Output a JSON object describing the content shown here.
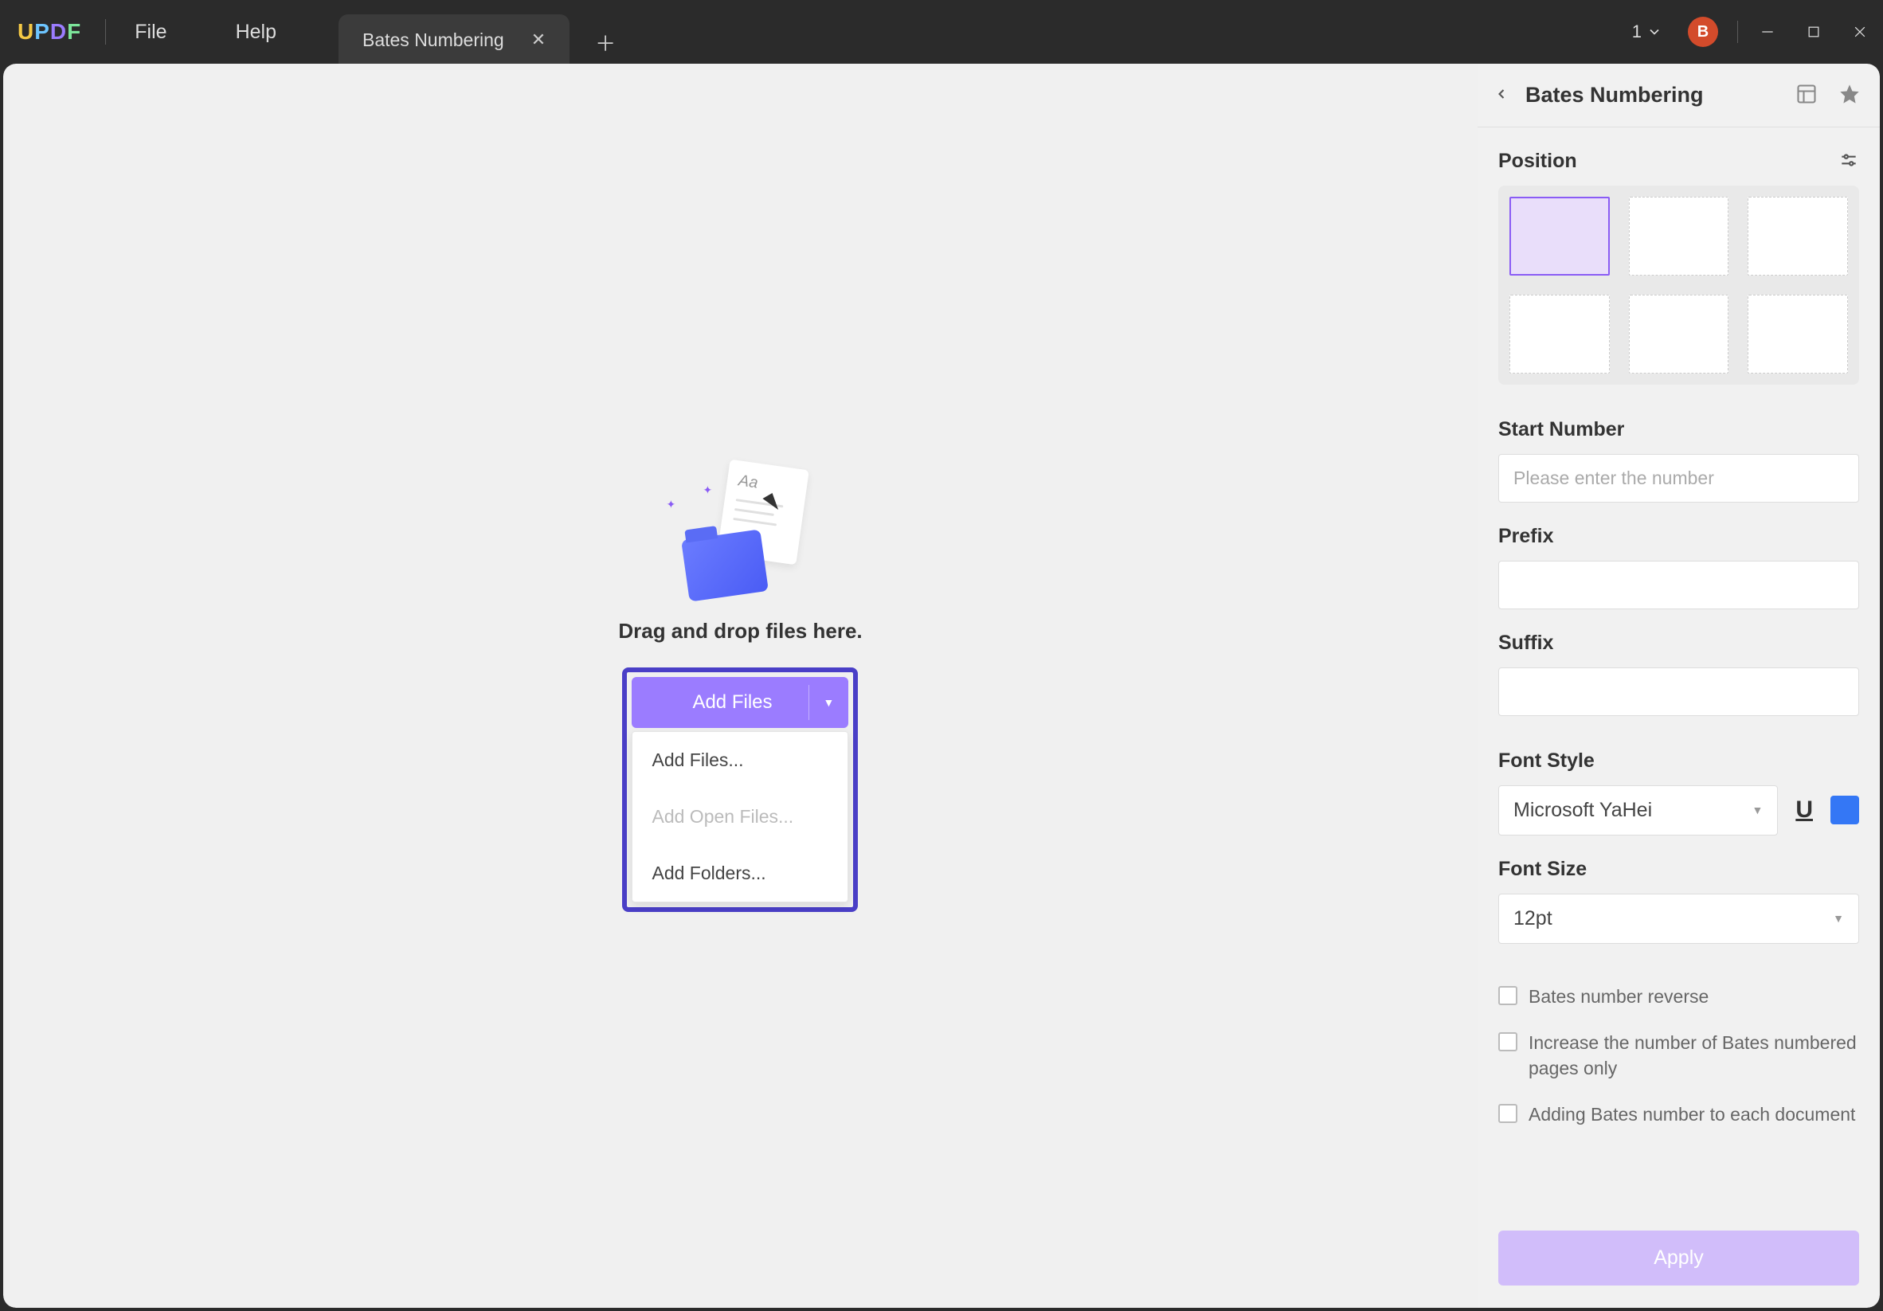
{
  "logo": {
    "l1": "U",
    "l2": "P",
    "l3": "D",
    "l4": "F"
  },
  "menu": {
    "file": "File",
    "help": "Help"
  },
  "tab": {
    "title": "Bates Numbering"
  },
  "window": {
    "dropdown_value": "1",
    "avatar_letter": "B"
  },
  "main": {
    "drop_text": "Drag and drop files here.",
    "add_files_btn": "Add Files",
    "dropdown": {
      "add_files": "Add Files...",
      "add_open_files": "Add Open Files...",
      "add_folders": "Add Folders..."
    }
  },
  "panel": {
    "title": "Bates Numbering",
    "position_label": "Position",
    "start_number_label": "Start Number",
    "start_number_placeholder": "Please enter the number",
    "prefix_label": "Prefix",
    "suffix_label": "Suffix",
    "font_style_label": "Font Style",
    "font_style_value": "Microsoft YaHei",
    "font_color": "#3477f5",
    "font_size_label": "Font Size",
    "font_size_value": "12pt",
    "check1": "Bates number reverse",
    "check2": "Increase the number of Bates numbered pages only",
    "check3": "Adding Bates number to each document",
    "apply": "Apply"
  }
}
